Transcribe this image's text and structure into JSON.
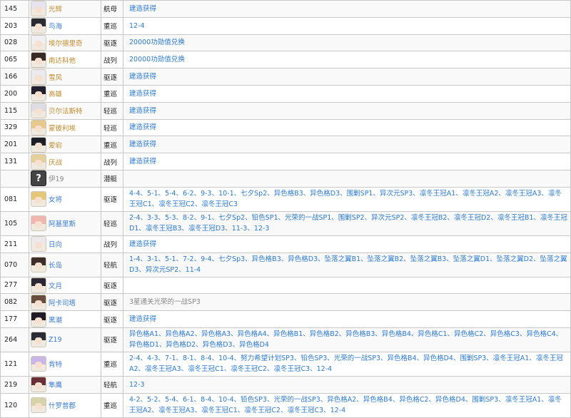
{
  "rows": [
    {
      "id": "145",
      "name": "光辉",
      "type": "航母",
      "source": "建造获得",
      "h": 2,
      "color": "gold",
      "hair": "#e8e4ef"
    },
    {
      "id": "203",
      "name": "鸟海",
      "type": "重巡",
      "source": "12-4",
      "h": 2,
      "color": "blue",
      "hair": "#2b2b35"
    },
    {
      "id": "028",
      "name": "埃尔德里奇",
      "type": "驱逐",
      "source": "20000功勋值兑换",
      "h": 2,
      "color": "gold",
      "hair": "#f0f0f4"
    },
    {
      "id": "065",
      "name": "南达科他",
      "type": "战列",
      "source": "20000功勋值兑换",
      "h": 2,
      "color": "gold",
      "hair": "#3a2a26"
    },
    {
      "id": "166",
      "name": "雪风",
      "type": "驱逐",
      "source": "建造获得",
      "h": 2,
      "color": "gold",
      "hair": "#e9e9ee"
    },
    {
      "id": "200",
      "name": "高雄",
      "type": "重巡",
      "source": "建造获得",
      "h": 2,
      "color": "gold",
      "hair": "#242030"
    },
    {
      "id": "115",
      "name": "贝尔法斯特",
      "type": "轻巡",
      "source": "建造获得",
      "h": 2,
      "color": "gold",
      "hair": "#dedbe4"
    },
    {
      "id": "329",
      "name": "蒙彼利埃",
      "type": "轻巡",
      "source": "建造获得",
      "h": 2,
      "color": "gold",
      "hair": "#e7c98e"
    },
    {
      "id": "201",
      "name": "爱宕",
      "type": "重巡",
      "source": "建造获得",
      "h": 2,
      "color": "gold",
      "hair": "#1e1e28"
    },
    {
      "id": "131",
      "name": "厌战",
      "type": "战列",
      "source": "建造获得",
      "h": 2,
      "color": "gold",
      "hair": "#e5cf9a"
    },
    {
      "id": "",
      "name": "伊19",
      "type": "潜艇",
      "source": "",
      "h": 2,
      "color": "gray",
      "hair": "unknown"
    },
    {
      "id": "081",
      "name": "女将",
      "type": "驱逐",
      "source": "4-4、5-1、5-4、6-2、9-3、10-1、七夕Sp2、异色格B3、异色格D3、围剿SP1、异次元SP3、凛冬王冠A1、凛冬王冠A2、凛冬王冠A3、凛冬王冠C1、凛冬王冠C2、凛冬王冠C3",
      "h": 3,
      "color": "blue",
      "hair": "#e5c77c"
    },
    {
      "id": "105",
      "name": "阿基里斯",
      "type": "轻巡",
      "source": "2-4、3-3、5-3、8-2、9-1、七夕Sp2、铅色SP1、光荣的一战SP1、围剿SP2、异次元SP2、凛冬王冠B2、凛冬王冠D2、凛冬王冠B1、凛冬王冠D1、凛冬王冠B3、凛冬王冠D3、11-3、12-3",
      "h": 3,
      "color": "blue",
      "hair": "#f2b6b0"
    },
    {
      "id": "211",
      "name": "日向",
      "type": "战列",
      "source": "建造获得",
      "h": 2,
      "color": "blue",
      "hair": "#ede8ec"
    },
    {
      "id": "070",
      "name": "长岛",
      "type": "轻航",
      "source": "1-4、3-1、5-1、7-2、9-4、七夕Sp3、异色格B3、异色格D3、坠落之翼B1、坠落之翼B2、坠落之翼B3、坠落之翼D1、坠落之翼D2、坠落之翼D3、异次元SP2、11-4",
      "h": 3,
      "color": "blue",
      "hair": "#3e2d28"
    },
    {
      "id": "277",
      "name": "文月",
      "type": "驱逐",
      "source": "",
      "h": 2,
      "color": "blue",
      "hair": "#2c2734"
    },
    {
      "id": "082",
      "name": "阿卡司塔",
      "type": "驱逐",
      "source": "3星通关光荣的一战SP3",
      "h": 2,
      "color": "blue",
      "hair": "#6b4d3d",
      "srcGray": true
    },
    {
      "id": "177",
      "name": "黑潮",
      "type": "驱逐",
      "source": "建造获得",
      "h": 2,
      "color": "blue",
      "hair": "#1f1c28"
    },
    {
      "id": "264",
      "name": "Z19",
      "type": "驱逐",
      "source": "异色格A1、异色格A2、异色格A3、异色格A4、异色格B1、异色格B2、异色格B3、异色格B4、异色格C1、异色格C2、异色格C3、异色格C4、异色格D1、异色格D2、异色格D3、异色格D4",
      "h": 3,
      "color": "blue",
      "hair": "#2a2a38"
    },
    {
      "id": "121",
      "name": "肯特",
      "type": "重巡",
      "source": "2-4、4-3、7-1、8-1、8-4、10-4、努力希望计划SP3、铅色SP3、光荣的一战SP3、异色格B4、异色格D4、围剿SP3、凛冬王冠A1、凛冬王冠A2、凛冬王冠A3、凛冬王冠C1、凛冬王冠C2、凛冬王冠C3、12-4",
      "h": 3,
      "color": "blue",
      "hair": "#c9b6e6"
    },
    {
      "id": "219",
      "name": "隼鹰",
      "type": "轻航",
      "source": "12-3",
      "h": 2,
      "color": "blue",
      "hair": "#6a3038"
    },
    {
      "id": "120",
      "name": "什罗普郡",
      "type": "重巡",
      "source": "4-2、5-2、5-4、6-1、8-4、10-4、铅色SP3、光荣的一战SP3、异色格A2、异色格B4、异色格C2、异色格D4、围剿SP3、凛冬王冠A1、凛冬王冠A2、凛冬王冠A3、凛冬王冠C1、凛冬王冠C2、凛冬王冠C3、12-4",
      "h": 3,
      "color": "blue",
      "hair": "#d8d2a8"
    }
  ]
}
